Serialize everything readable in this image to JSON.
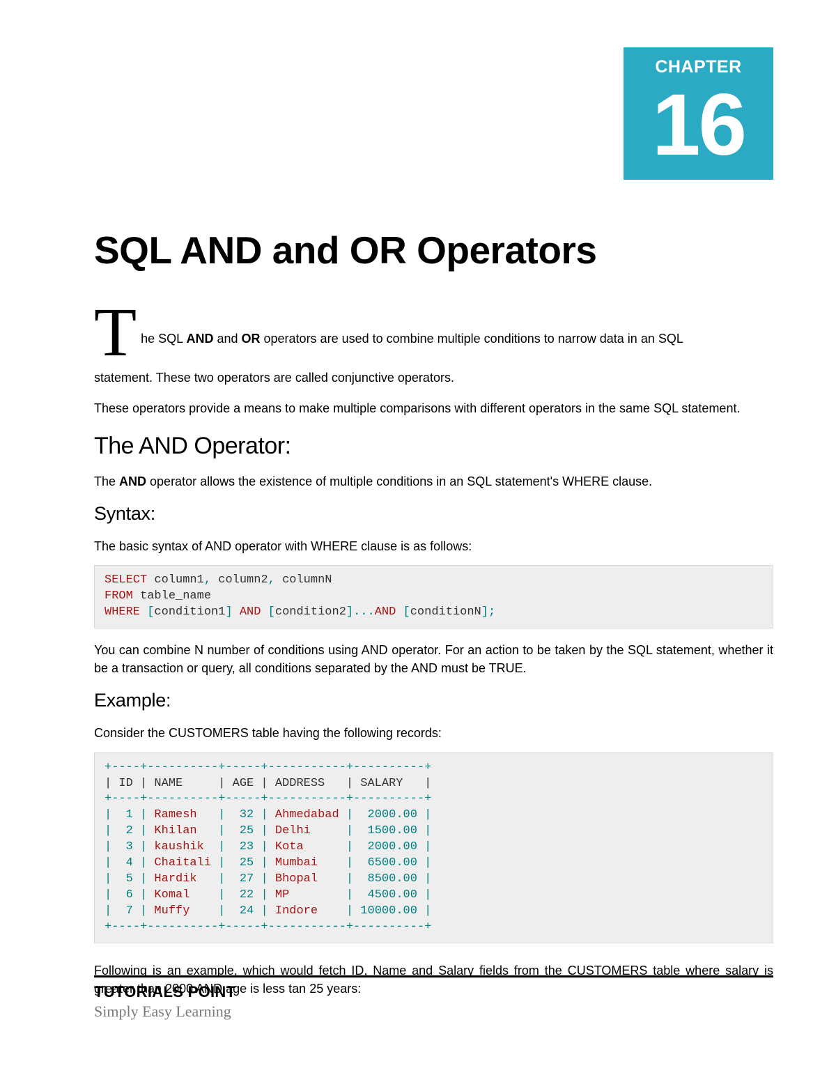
{
  "chapter": {
    "label": "CHAPTER",
    "number": "16"
  },
  "title": "SQL AND and OR Operators",
  "intro": {
    "dropcap": "T",
    "first_line_prefix": "he SQL ",
    "bold1": "AND",
    "mid1": " and ",
    "bold2": "OR",
    "first_line_suffix": " operators are used to combine multiple conditions to narrow data in an SQL",
    "line2": "statement. These two operators are called conjunctive operators.",
    "line3": "These operators provide a means to make multiple comparisons with different operators in the same SQL statement."
  },
  "and_section": {
    "heading": "The AND Operator:",
    "desc_prefix": "The ",
    "desc_bold": "AND",
    "desc_suffix": " operator allows the existence of multiple conditions in an SQL statement's WHERE clause.",
    "syntax_heading": "Syntax:",
    "syntax_desc": "The basic syntax of AND operator with WHERE clause is as follows:",
    "after_syntax": "You can combine N number of conditions using AND operator. For an action to be taken by the SQL statement, whether it be a transaction or query, all conditions separated by the AND must be TRUE.",
    "example_heading": "Example:",
    "example_desc": "Consider the CUSTOMERS table having the following records:",
    "after_table": "Following is an example, which would fetch ID, Name and Salary fields from the CUSTOMERS table where salary is greater than 2000 AND age is less tan 25 years:"
  },
  "syntax_code": {
    "l1a": "SELECT",
    "l1b": " column1",
    "l1c": ",",
    "l1d": " column2",
    "l1e": ",",
    "l1f": " columnN ",
    "l2a": "FROM",
    "l2b": " table_name",
    "l3a": "WHERE ",
    "l3b": "[",
    "l3c": "condition1",
    "l3d": "]",
    "l3e": " AND ",
    "l3f": "[",
    "l3g": "condition2",
    "l3h": "]...",
    "l3i": "AND ",
    "l3j": "[",
    "l3k": "conditionN",
    "l3l": "];"
  },
  "table_code": {
    "border": "+----+----------+-----+-----------+----------+",
    "header_a": "| ID | NAME     | AGE | ADDRESS   | SALARY   |",
    "rows": [
      {
        "p1": "|  ",
        "id": "1",
        "p2": " | ",
        "name": "Ramesh  ",
        "p3": " |  ",
        "age": "32",
        "p4": " | ",
        "addr": "Ahmedabad",
        "p5": " |  ",
        "sal": "2000.00",
        "p6": " |"
      },
      {
        "p1": "|  ",
        "id": "2",
        "p2": " | ",
        "name": "Khilan  ",
        "p3": " |  ",
        "age": "25",
        "p4": " | ",
        "addr": "Delhi    ",
        "p5": " |  ",
        "sal": "1500.00",
        "p6": " |"
      },
      {
        "p1": "|  ",
        "id": "3",
        "p2": " | ",
        "name": "kaushik ",
        "p3": " |  ",
        "age": "23",
        "p4": " | ",
        "addr": "Kota     ",
        "p5": " |  ",
        "sal": "2000.00",
        "p6": " |"
      },
      {
        "p1": "|  ",
        "id": "4",
        "p2": " | ",
        "name": "Chaitali",
        "p3": " |  ",
        "age": "25",
        "p4": " | ",
        "addr": "Mumbai   ",
        "p5": " |  ",
        "sal": "6500.00",
        "p6": " |"
      },
      {
        "p1": "|  ",
        "id": "5",
        "p2": " | ",
        "name": "Hardik  ",
        "p3": " |  ",
        "age": "27",
        "p4": " | ",
        "addr": "Bhopal   ",
        "p5": " |  ",
        "sal": "8500.00",
        "p6": " |"
      },
      {
        "p1": "|  ",
        "id": "6",
        "p2": " | ",
        "name": "Komal   ",
        "p3": " |  ",
        "age": "22",
        "p4": " | ",
        "addr": "MP       ",
        "p5": " |  ",
        "sal": "4500.00",
        "p6": " |"
      },
      {
        "p1": "|  ",
        "id": "7",
        "p2": " | ",
        "name": "Muffy   ",
        "p3": " |  ",
        "age": "24",
        "p4": " | ",
        "addr": "Indore   ",
        "p5": " | ",
        "sal": "10000.00",
        "p6": " |"
      }
    ]
  },
  "footer": {
    "title": "TUTORIALS POINT",
    "sub": "Simply Easy Learning"
  }
}
